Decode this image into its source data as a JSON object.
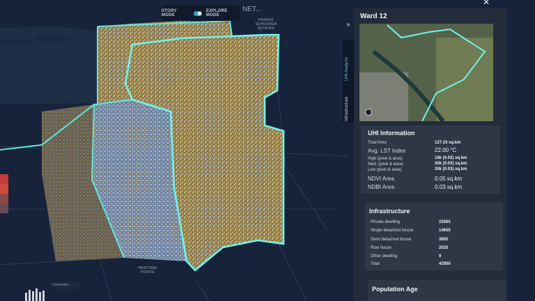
{
  "mode_toggle": {
    "story_label": "STORY MODE",
    "explore_label": "EXPLORE MODE",
    "explore_active": true
  },
  "top_search_text": "NET...",
  "map_labels": {
    "prairie": "PRAIRIE\nSCHOONER\nESTATES",
    "heritage": "HERITAGE\nPOINTE"
  },
  "left_controls": {
    "generator_label": "Generator"
  },
  "side_tabs": [
    "UHI Analysis",
    "Infrastructure"
  ],
  "panel": {
    "title": "Ward 12",
    "uhi": {
      "title": "UHI Information",
      "rows": [
        {
          "label": "Total Area",
          "value": "127.33 sq.km"
        },
        {
          "label": "Avg. LST Index",
          "value": "22.00 °C"
        },
        {
          "label": "High (pixel & area)",
          "value": "18k (0.02) sq.km"
        },
        {
          "label": "Med. (pixel & area)",
          "value": "30k (0.03) sq.km"
        },
        {
          "label": "Low (pixel & area)",
          "value": "30k (0.03) sq.km"
        },
        {
          "label": "NDVI Area",
          "value": "0.05 sq.km"
        },
        {
          "label": "NDBI Area",
          "value": "0.03 sq.km"
        }
      ]
    },
    "infrastructure": {
      "title": "Infrastructure",
      "rows": [
        {
          "label": "Private dwelling",
          "value": "22565"
        },
        {
          "label": "Single detached house",
          "value": "14655"
        },
        {
          "label": "Semi detached house",
          "value": "3805"
        },
        {
          "label": "Row house",
          "value": "2025"
        },
        {
          "label": "Other dwelling",
          "value": "0"
        },
        {
          "label": "Total",
          "value": "42950"
        }
      ]
    },
    "population": {
      "title": "Population Age"
    }
  },
  "colors": {
    "boundary": "#5ee8df",
    "panel": "#232c3a",
    "card": "#2e3746",
    "heat_high": "#c9a85a",
    "heat_low": "#7fa2c8"
  }
}
